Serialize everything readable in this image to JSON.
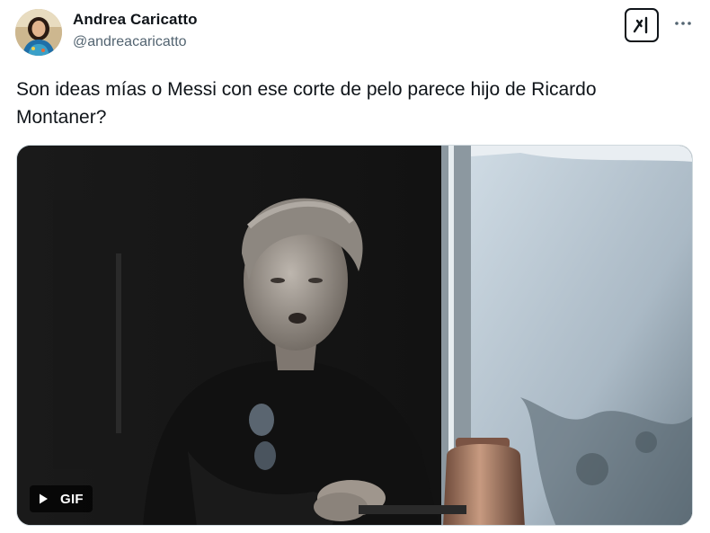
{
  "author": {
    "display_name": "Andrea Caricatto",
    "handle": "@andreacaricatto",
    "avatar_icon": "profile-photo"
  },
  "header_actions": {
    "grok_icon": "grok-icon",
    "more_icon": "more-options-icon"
  },
  "tweet": {
    "text": "Son ideas mías o Messi con ese corte de pelo parece hijo de Ricardo Montaner?"
  },
  "media": {
    "type": "gif",
    "badge_label": "GIF",
    "play_icon": "play-icon"
  },
  "colors": {
    "text_primary": "#0f1419",
    "text_secondary": "#536471",
    "border": "#cfd9de"
  }
}
